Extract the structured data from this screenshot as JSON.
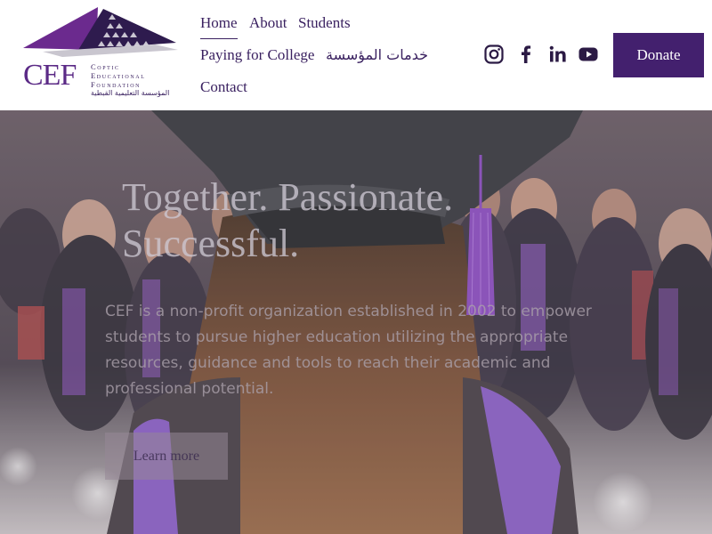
{
  "header": {
    "logo": {
      "abbr": "CEF",
      "name_line1": "Coptic",
      "name_line2": "Educational",
      "name_line3": "Foundation",
      "arabic_name": "المؤسسة التعليمية القبطية"
    },
    "nav": [
      {
        "label": "Home",
        "active": true
      },
      {
        "label": "About"
      },
      {
        "label": "Students"
      },
      {
        "label": "Paying for College"
      },
      {
        "label": "خدمات المؤسسة"
      },
      {
        "label": "Contact"
      }
    ],
    "social": [
      {
        "icon": "instagram-icon"
      },
      {
        "icon": "facebook-icon"
      },
      {
        "icon": "linkedin-icon"
      },
      {
        "icon": "youtube-icon"
      }
    ],
    "donate_label": "Donate"
  },
  "hero": {
    "title_line1": "Together. Passionate.",
    "title_line2": "Successful.",
    "description": "CEF is a non-profit organization established in 2002 to empower students to pursue higher education utilizing the appropriate resources, guidance and tools to reach their academic and professional potential.",
    "button_label": "Learn more"
  },
  "colors": {
    "brand_purple": "#43206e",
    "logo_purple": "#5b2a86",
    "text_dark": "#3a2160"
  }
}
